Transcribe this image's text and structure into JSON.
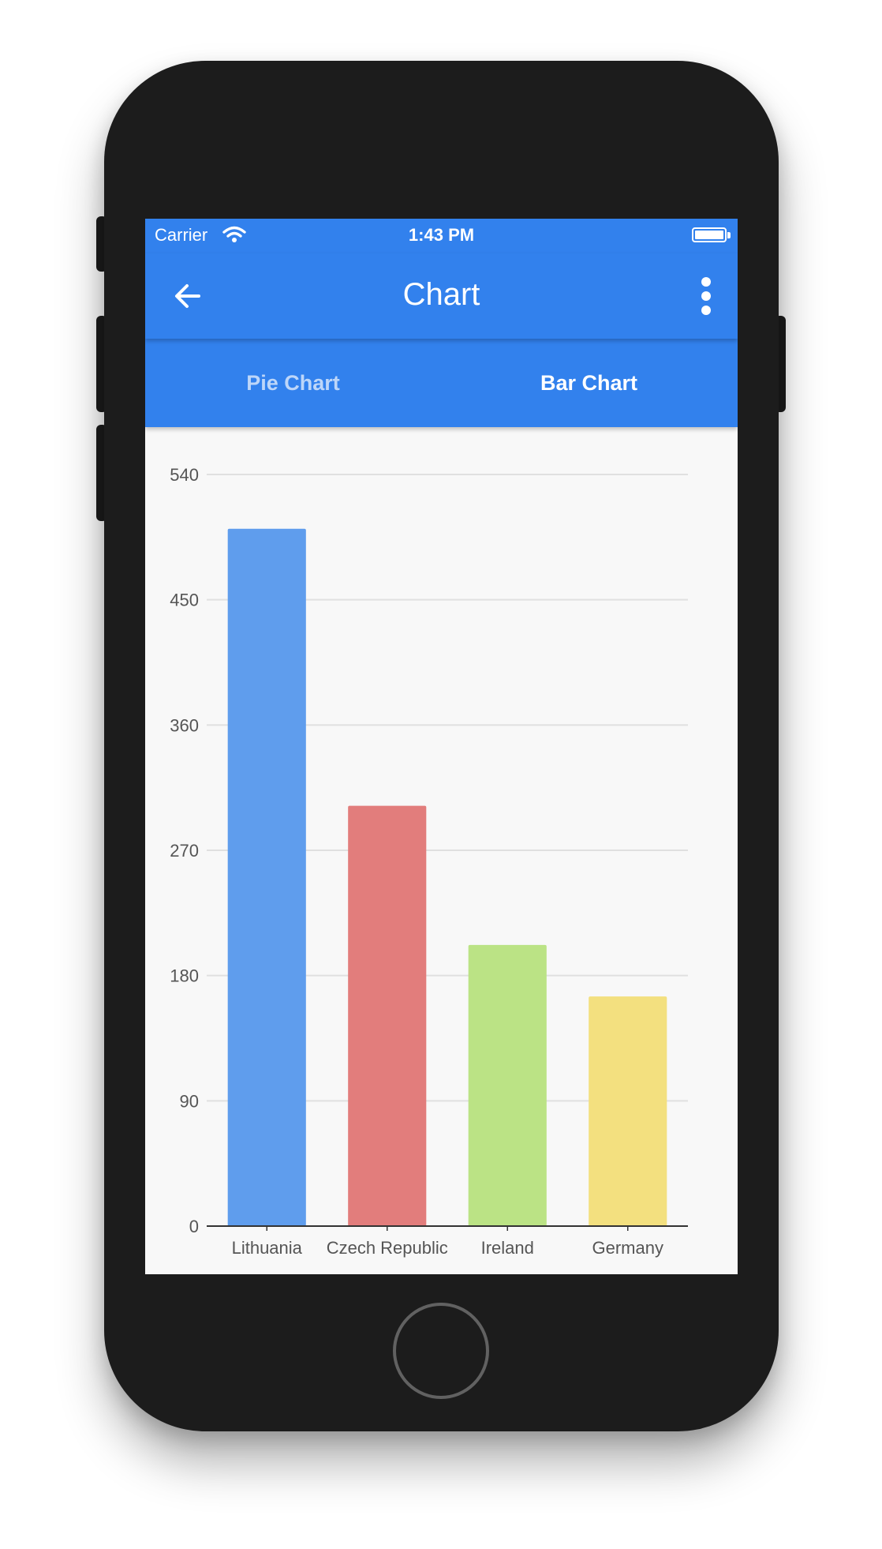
{
  "status_bar": {
    "carrier": "Carrier",
    "time": "1:43 PM",
    "wifi_icon": "wifi-icon",
    "battery_icon": "battery-icon"
  },
  "app_bar": {
    "title": "Chart",
    "back_icon": "arrow-left-icon",
    "more_icon": "more-vertical-icon"
  },
  "tabs": [
    {
      "label": "Pie Chart",
      "selected": false
    },
    {
      "label": "Bar Chart",
      "selected": true
    }
  ],
  "colors": {
    "app_bar": "#3281ed",
    "background": "#f8f8f8"
  },
  "chart_data": {
    "type": "bar",
    "categories": [
      "Lithuania",
      "Czech Republic",
      "Ireland",
      "Germany"
    ],
    "values": [
      501,
      302,
      202,
      165
    ],
    "colors": [
      "#5f9ded",
      "#e27d7c",
      "#bbe385",
      "#f3e07f"
    ],
    "yticks": [
      "0",
      "90",
      "180",
      "270",
      "360",
      "450",
      "540"
    ],
    "ylim": [
      0,
      540
    ],
    "grid": true,
    "title": "",
    "xlabel": "",
    "ylabel": ""
  }
}
